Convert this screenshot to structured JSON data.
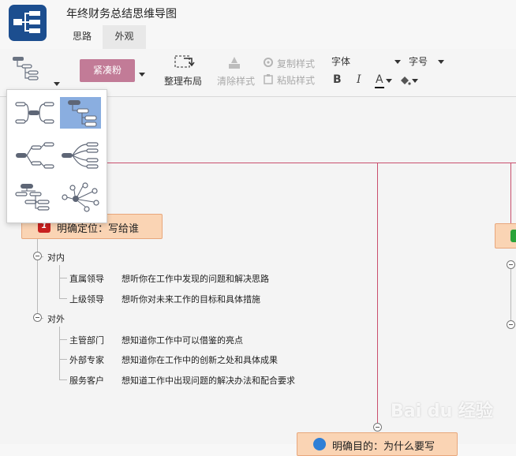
{
  "app": {
    "title": "年终财务总结思维导图"
  },
  "tabs": [
    {
      "label": "思路"
    },
    {
      "label": "外观"
    }
  ],
  "toolbar": {
    "theme_label": "紧凑粉",
    "arrange_label": "整理布局",
    "clear_style_label": "清除样式",
    "copy_style_label": "复制样式",
    "paste_style_label": "粘贴样式",
    "font_label": "字体",
    "size_label": "字号",
    "bold": "B",
    "italic": "I",
    "font_color": "A",
    "accent_color": "#c27b97"
  },
  "mindmap": {
    "topic1": {
      "number": "1",
      "label": "明确定位：写给谁"
    },
    "groups": [
      {
        "label": "对内",
        "items": [
          {
            "role": "直属领导",
            "desc": "想听你在工作中发现的问题和解决思路"
          },
          {
            "role": "上级领导",
            "desc": "想听你对未来工作的目标和具体措施"
          }
        ]
      },
      {
        "label": "对外",
        "items": [
          {
            "role": "主管部门",
            "desc": "想知道你工作中可以借鉴的亮点"
          },
          {
            "role": "外部专家",
            "desc": "想知道你在工作中的创新之处和具体成果"
          },
          {
            "role": "服务客户",
            "desc": "想知道工作中出现问题的解决办法和配合要求"
          }
        ]
      }
    ],
    "topic2_partial": "明确目的：为什么要写"
  },
  "watermark": "Bai du 经验"
}
